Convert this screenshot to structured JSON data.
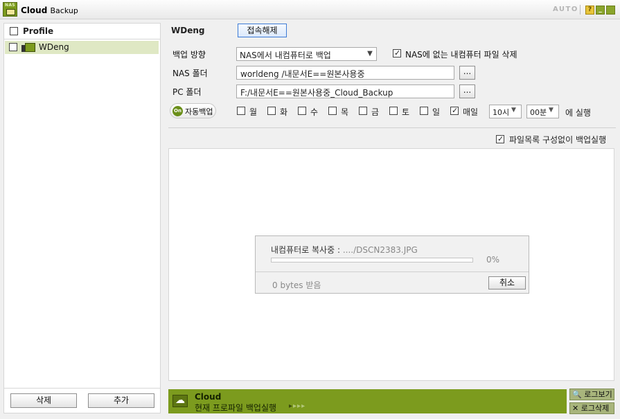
{
  "app": {
    "logo_text": "NAS",
    "title_main": "Cloud",
    "title_sub": "Backup",
    "auto_label": "AUTO",
    "help_glyph": "?"
  },
  "sidebar": {
    "header_label": "Profile",
    "profiles": [
      {
        "name": "WDeng",
        "selected": true
      }
    ],
    "delete_label": "삭제",
    "add_label": "추가"
  },
  "profile": {
    "name": "WDeng",
    "disconnect_label": "접속해제"
  },
  "settings": {
    "direction_label": "백업 방향",
    "direction_value": "NAS에서 내컴퓨터로 백업",
    "delete_missing_label": "NAS에 없는 내컴퓨터 파일 삭제",
    "delete_missing_checked": true,
    "nas_folder_label": "NAS 폴더",
    "nas_folder_value": "worldeng /내문서E==원본사용중",
    "pc_folder_label": "PC 폴더",
    "pc_folder_value": "F:/내문서E==원본사용중_Cloud_Backup",
    "browse_label": "..."
  },
  "schedule": {
    "toggle_state": "On",
    "toggle_label": "자동백업",
    "days": [
      {
        "label": "월",
        "checked": false
      },
      {
        "label": "화",
        "checked": false
      },
      {
        "label": "수",
        "checked": false
      },
      {
        "label": "목",
        "checked": false
      },
      {
        "label": "금",
        "checked": false
      },
      {
        "label": "토",
        "checked": false
      },
      {
        "label": "일",
        "checked": false
      },
      {
        "label": "매일",
        "checked": true
      }
    ],
    "hour_value": "10시",
    "minute_value": "00분",
    "run_suffix": "에 실행"
  },
  "options": {
    "skip_list_label": "파일목록 구성없이 백업실행",
    "skip_list_checked": true
  },
  "progress": {
    "status_prefix": "내컴퓨터로 복사중 :",
    "file": "..../DSCN2383.JPG",
    "percent_text": "0%",
    "percent": 0,
    "bytes_text": "0 bytes 받음",
    "cancel_label": "취소"
  },
  "footer": {
    "run_title": "Cloud",
    "run_text": "현재 프로파일 백업실행",
    "view_log_label": "로그보기",
    "delete_log_label": "로그삭제"
  },
  "icons": {
    "help": "help-icon",
    "minimize": "minimize-icon",
    "close": "close-icon",
    "search": "search-icon",
    "delete": "x-icon",
    "cloud": "cloud-icon"
  },
  "colors": {
    "accent": "#7c9b1e",
    "selected_row": "#dfe8c4",
    "log_button": "#a8b57c"
  }
}
